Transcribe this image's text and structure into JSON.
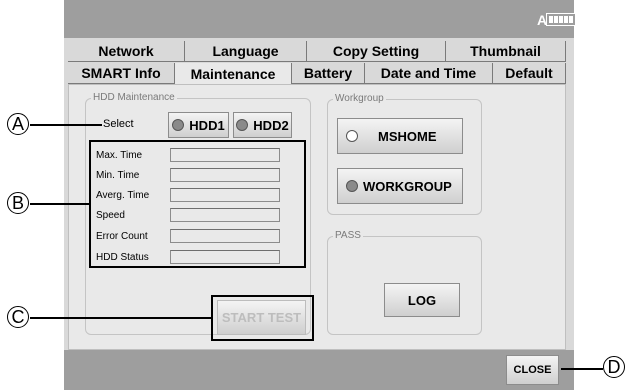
{
  "header": {
    "battery_label": "A"
  },
  "tabs_row1": [
    "Network",
    "Language",
    "Copy Setting",
    "Thumbnail"
  ],
  "tabs_row2": [
    "SMART Info",
    "Maintenance",
    "Battery",
    "Date and Time",
    "Default"
  ],
  "hdd_maintenance": {
    "title": "HDD Maintenance",
    "select_label": "Select",
    "hdd1_label": "HDD1",
    "hdd2_label": "HDD2",
    "fields": [
      "Max. Time",
      "Min. Time",
      "Averg. Time",
      "Speed",
      "Error Count",
      "HDD Status"
    ],
    "start_test_label": "START TEST"
  },
  "workgroup": {
    "title": "Workgroup",
    "mshome_label": "MSHOME",
    "workgroup_label": "WORKGROUP",
    "selected": "WORKGROUP"
  },
  "pass": {
    "title": "PASS",
    "log_label": "LOG"
  },
  "footer": {
    "close_label": "CLOSE"
  },
  "callouts": {
    "a": "A",
    "b": "B",
    "c": "C",
    "d": "D"
  }
}
